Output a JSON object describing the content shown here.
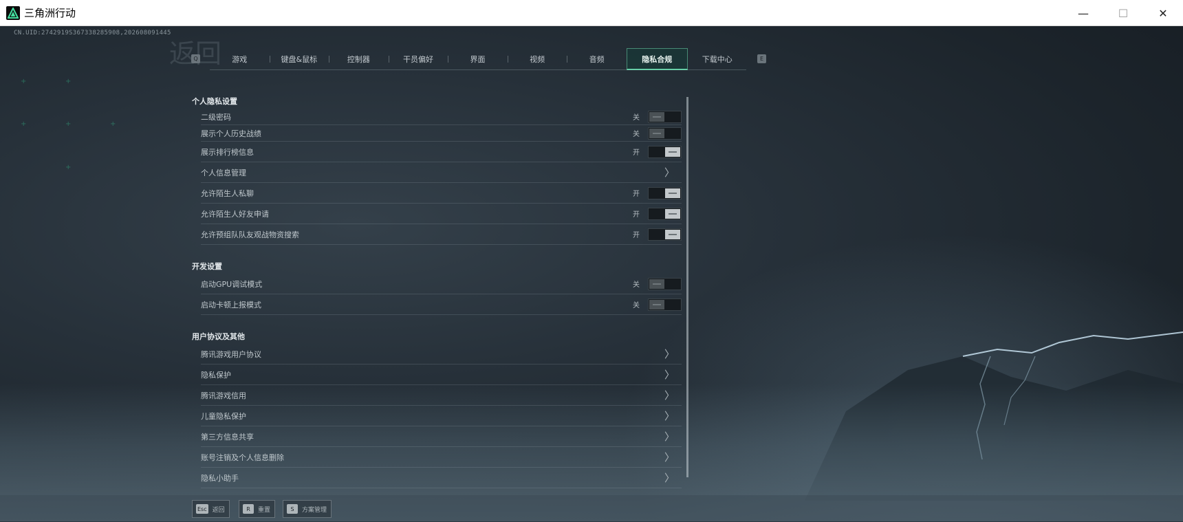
{
  "window": {
    "title": "三角洲行动",
    "controls": {
      "minimize": "—",
      "maximize": "☐",
      "close": "✕"
    }
  },
  "game": {
    "uid": "CN.UID:2742919S367338285908,202608091445",
    "bg_glyph": "返回"
  },
  "tabs": {
    "left_key": "Q",
    "right_key": "E",
    "active_index": 7,
    "items": [
      {
        "label": "游戏"
      },
      {
        "label": "键盘&鼠标"
      },
      {
        "label": "控制器"
      },
      {
        "label": "干员偏好"
      },
      {
        "label": "界面"
      },
      {
        "label": "视频"
      },
      {
        "label": "音频"
      },
      {
        "label": "隐私合规"
      },
      {
        "label": "下载中心"
      }
    ]
  },
  "privacy": {
    "title": "个人隐私设置",
    "rows": [
      {
        "label": "二级密码",
        "type": "toggle",
        "state": "关",
        "on": false
      },
      {
        "label": "展示个人历史战绩",
        "type": "toggle",
        "state": "关",
        "on": false
      },
      {
        "label": "展示排行榜信息",
        "type": "toggle",
        "state": "开",
        "on": true
      },
      {
        "label": "个人信息管理",
        "type": "link"
      },
      {
        "label": "允许陌生人私聊",
        "type": "toggle",
        "state": "开",
        "on": true
      },
      {
        "label": "允许陌生人好友申请",
        "type": "toggle",
        "state": "开",
        "on": true
      },
      {
        "label": "允许预组队队友观战物资搜索",
        "type": "toggle",
        "state": "开",
        "on": true
      }
    ]
  },
  "dev": {
    "title": "开发设置",
    "rows": [
      {
        "label": "启动GPU调试模式",
        "type": "toggle",
        "state": "关",
        "on": false
      },
      {
        "label": "启动卡顿上报模式",
        "type": "toggle",
        "state": "关",
        "on": false
      }
    ]
  },
  "agreements": {
    "title": "用户协议及其他",
    "rows": [
      {
        "label": "腾讯游戏用户协议",
        "type": "link"
      },
      {
        "label": "隐私保护",
        "type": "link"
      },
      {
        "label": "腾讯游戏信用",
        "type": "link"
      },
      {
        "label": "儿童隐私保护",
        "type": "link"
      },
      {
        "label": "第三方信息共享",
        "type": "link"
      },
      {
        "label": "账号注销及个人信息删除",
        "type": "link"
      },
      {
        "label": "隐私小助手",
        "type": "link"
      }
    ]
  },
  "footer": {
    "buttons": [
      {
        "key": "Esc",
        "label": "返回"
      },
      {
        "key": "R",
        "label": "重置"
      },
      {
        "key": "S",
        "label": "方案管理"
      }
    ]
  },
  "chevron_glyph": "〉",
  "colors": {
    "accent": "#5fd8a8",
    "text": "#bfc7cc",
    "bg": "#1c2329"
  }
}
